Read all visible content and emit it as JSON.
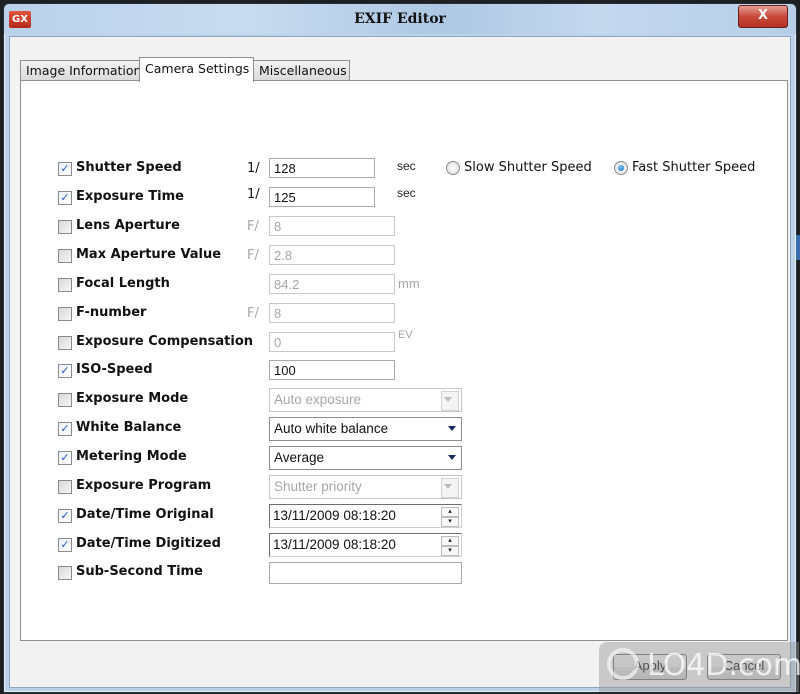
{
  "window": {
    "title": "EXIF Editor",
    "app_icon": "GX",
    "close_label": "X"
  },
  "tabs": [
    {
      "label": "Image Information",
      "active": false
    },
    {
      "label": "Camera Settings",
      "active": true
    },
    {
      "label": "Miscellaneous",
      "active": false
    }
  ],
  "fields": {
    "shutter_speed": {
      "label": "Shutter Speed",
      "checked": true,
      "prefix": "1/",
      "value": "128",
      "suffix": "sec"
    },
    "exposure_time": {
      "label": "Exposure Time",
      "checked": true,
      "prefix": "1/",
      "value": "125",
      "suffix": "sec"
    },
    "lens_aperture": {
      "label": "Lens Aperture",
      "checked": false,
      "prefix": "F/",
      "value": "8"
    },
    "max_aperture": {
      "label": "Max Aperture Value",
      "checked": false,
      "prefix": "F/",
      "value": "2.8"
    },
    "focal_length": {
      "label": "Focal Length",
      "checked": false,
      "value": "84.2",
      "suffix": "mm"
    },
    "f_number": {
      "label": "F-number",
      "checked": false,
      "prefix": "F/",
      "value": "8"
    },
    "exposure_comp": {
      "label": "Exposure Compensation",
      "checked": false,
      "value": "0",
      "suffix": "EV"
    },
    "iso_speed": {
      "label": "ISO-Speed",
      "checked": true,
      "value": "100"
    },
    "exposure_mode": {
      "label": "Exposure Mode",
      "checked": false,
      "value": "Auto exposure"
    },
    "white_balance": {
      "label": "White Balance",
      "checked": true,
      "value": "Auto white balance"
    },
    "metering_mode": {
      "label": "Metering Mode",
      "checked": true,
      "value": "Average"
    },
    "exposure_program": {
      "label": "Exposure Program",
      "checked": false,
      "value": "Shutter priority"
    },
    "datetime_original": {
      "label": "Date/Time Original",
      "checked": true,
      "value": "13/11/2009 08:18:20"
    },
    "datetime_digitized": {
      "label": "Date/Time Digitized",
      "checked": true,
      "value": "13/11/2009 08:18:20"
    },
    "subsecond_time": {
      "label": "Sub-Second Time",
      "checked": false,
      "value": ""
    }
  },
  "shutter_mode": {
    "slow_label": "Slow Shutter Speed",
    "fast_label": "Fast Shutter Speed",
    "selected": "fast"
  },
  "buttons": {
    "apply": "Apply",
    "cancel": "Cancel"
  },
  "watermark": "LO4D.com",
  "check_glyph": "✓"
}
